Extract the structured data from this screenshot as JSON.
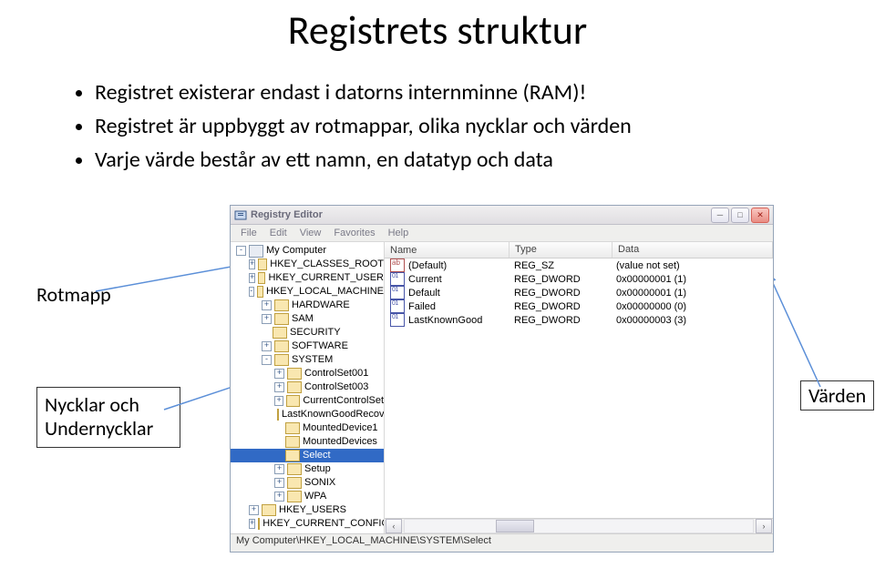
{
  "title": "Registrets struktur",
  "bullets": [
    "Registret existerar endast i datorns internminne (RAM)!",
    "Registret är uppbyggt av rotmappar, olika nycklar och värden",
    "Varje värde består av ett namn, en datatyp och data"
  ],
  "labels": {
    "rotmapp": "Rotmapp",
    "nycklar": "Nycklar och Undernycklar",
    "varden": "Värden"
  },
  "window": {
    "title": "Registry Editor",
    "menubar": [
      "File",
      "Edit",
      "View",
      "Favorites",
      "Help"
    ],
    "statusbar": "My Computer\\HKEY_LOCAL_MACHINE\\SYSTEM\\Select",
    "list": {
      "headers": [
        "Name",
        "Type",
        "Data"
      ],
      "rows": [
        {
          "icon": "str",
          "name": "(Default)",
          "type": "REG_SZ",
          "data": "(value not set)"
        },
        {
          "icon": "bin",
          "name": "Current",
          "type": "REG_DWORD",
          "data": "0x00000001 (1)"
        },
        {
          "icon": "bin",
          "name": "Default",
          "type": "REG_DWORD",
          "data": "0x00000001 (1)"
        },
        {
          "icon": "bin",
          "name": "Failed",
          "type": "REG_DWORD",
          "data": "0x00000000 (0)"
        },
        {
          "icon": "bin",
          "name": "LastKnownGood",
          "type": "REG_DWORD",
          "data": "0x00000003 (3)"
        }
      ]
    },
    "tree": [
      {
        "depth": 0,
        "exp": "-",
        "icon": "comp",
        "label": "My Computer"
      },
      {
        "depth": 1,
        "exp": "+",
        "icon": "fld",
        "label": "HKEY_CLASSES_ROOT"
      },
      {
        "depth": 1,
        "exp": "+",
        "icon": "fld",
        "label": "HKEY_CURRENT_USER"
      },
      {
        "depth": 1,
        "exp": "-",
        "icon": "fld",
        "label": "HKEY_LOCAL_MACHINE"
      },
      {
        "depth": 2,
        "exp": "+",
        "icon": "fld",
        "label": "HARDWARE"
      },
      {
        "depth": 2,
        "exp": "+",
        "icon": "fld",
        "label": "SAM"
      },
      {
        "depth": 2,
        "exp": " ",
        "icon": "fld",
        "label": "SECURITY"
      },
      {
        "depth": 2,
        "exp": "+",
        "icon": "fld",
        "label": "SOFTWARE"
      },
      {
        "depth": 2,
        "exp": "-",
        "icon": "fld",
        "label": "SYSTEM"
      },
      {
        "depth": 3,
        "exp": "+",
        "icon": "fld",
        "label": "ControlSet001"
      },
      {
        "depth": 3,
        "exp": "+",
        "icon": "fld",
        "label": "ControlSet003"
      },
      {
        "depth": 3,
        "exp": "+",
        "icon": "fld",
        "label": "CurrentControlSet"
      },
      {
        "depth": 3,
        "exp": " ",
        "icon": "fld",
        "label": "LastKnownGoodRecovery"
      },
      {
        "depth": 3,
        "exp": " ",
        "icon": "fld",
        "label": "MountedDevice1"
      },
      {
        "depth": 3,
        "exp": " ",
        "icon": "fld",
        "label": "MountedDevices"
      },
      {
        "depth": 3,
        "exp": " ",
        "icon": "fld",
        "label": "Select",
        "sel": true
      },
      {
        "depth": 3,
        "exp": "+",
        "icon": "fld",
        "label": "Setup"
      },
      {
        "depth": 3,
        "exp": "+",
        "icon": "fld",
        "label": "SONIX"
      },
      {
        "depth": 3,
        "exp": "+",
        "icon": "fld",
        "label": "WPA"
      },
      {
        "depth": 1,
        "exp": "+",
        "icon": "fld",
        "label": "HKEY_USERS"
      },
      {
        "depth": 1,
        "exp": "+",
        "icon": "fld",
        "label": "HKEY_CURRENT_CONFIG"
      }
    ]
  }
}
